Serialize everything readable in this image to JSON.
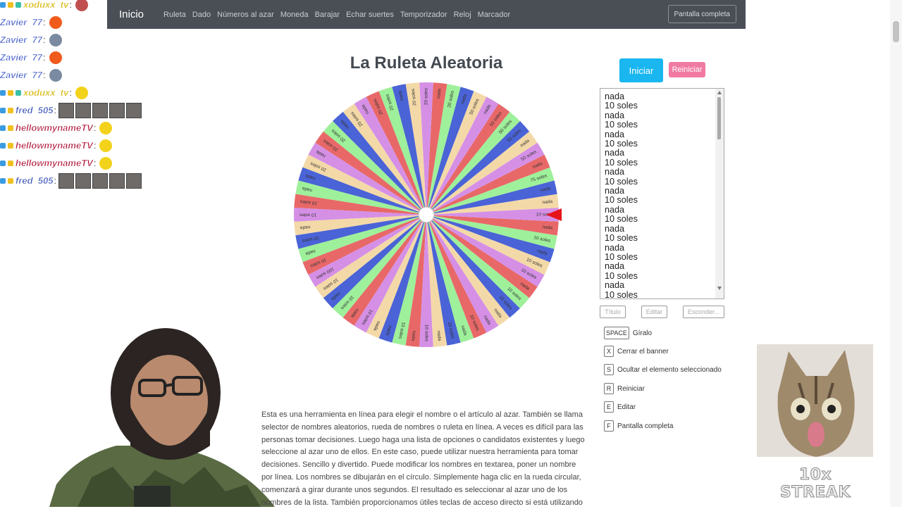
{
  "navbar": {
    "brand": "Inicio",
    "links": [
      "Ruleta",
      "Dado",
      "Números al azar",
      "Moneda",
      "Barajar",
      "Echar suertes",
      "Temporizador",
      "Reloj",
      "Marcador"
    ],
    "fullscreen": "Pantalla completa"
  },
  "chat": [
    {
      "user": "xoduxx_tv",
      "color": "#d4b400",
      "emotes": [
        "bomb-icon"
      ]
    },
    {
      "user": "Zavier_77",
      "color": "#4a63c9",
      "emotes": [
        "fire-icon"
      ]
    },
    {
      "user": "Zavier_77",
      "color": "#4a63c9",
      "emotes": [
        "bird-icon"
      ]
    },
    {
      "user": "Zavier_77",
      "color": "#4a63c9",
      "emotes": [
        "fire-icon"
      ]
    },
    {
      "user": "Zavier_77",
      "color": "#4a63c9",
      "emotes": [
        "bird-icon"
      ]
    },
    {
      "user": "xoduxx_tv",
      "color": "#d4b400",
      "emotes": [
        "clock-emote-icon"
      ]
    },
    {
      "user": "fred_505",
      "color": "#3a52b8",
      "emotes": [
        "face-emote-icon",
        "face-emote-icon",
        "face-emote-icon",
        "face-emote-icon",
        "face-emote-icon"
      ]
    },
    {
      "user": "hellowmynameTV",
      "color": "#b0183c",
      "emotes": [
        "clock-emote-icon"
      ]
    },
    {
      "user": "hellowmynameTV",
      "color": "#b0183c",
      "emotes": [
        "clock-emote-icon"
      ]
    },
    {
      "user": "hellowmynameTV",
      "color": "#b0183c",
      "emotes": [
        "clock-emote-icon"
      ]
    },
    {
      "user": "fred_505",
      "color": "#3a52b8",
      "emotes": [
        "face-emote-icon",
        "face-emote-icon",
        "face-emote-icon",
        "face-emote-icon",
        "face-emote-icon"
      ]
    }
  ],
  "main": {
    "title": "La Ruleta Aleatoria",
    "start_button": "Iniciar",
    "reset_button": "Reiniciar",
    "entries": [
      "nada",
      "10 soles",
      "nada",
      "10 soles",
      "nada",
      "10 soles",
      "nada",
      "10 soles",
      "nada",
      "10 soles",
      "nada",
      "10 soles",
      "nada",
      "10 soles",
      "nada",
      "10 soles",
      "nada",
      "10 soles",
      "nada",
      "10 soles",
      "nada",
      "10 soles"
    ],
    "small_buttons": [
      "Título",
      "Editar",
      "Esconder..."
    ],
    "shortcuts": [
      {
        "key": "SPACE",
        "label": "Gíralo"
      },
      {
        "key": "X",
        "label": "Cerrar el banner"
      },
      {
        "key": "S",
        "label": "Ocultar el elemento seleccionado"
      },
      {
        "key": "R",
        "label": "Reiniciar"
      },
      {
        "key": "E",
        "label": "Editar"
      },
      {
        "key": "F",
        "label": "Pantalla completa"
      }
    ],
    "description": "Esta es una herramienta en línea para elegir el nombre o el artículo al azar. También se llama selector de nombres aleatorios, rueda de nombres o ruleta en línea. A veces es difícil para las personas tomar decisiones. Luego haga una lista de opciones o candidatos existentes y luego seleccione al azar uno de ellos. En este caso, puede utilizar nuestra herramienta para tomar decisiones. Sencillo y divertido. Puede modificar los nombres en textarea, poner un nombre por línea. Los nombres se dibujarán en el círculo. Simplemente haga clic en la rueda circular, comenzará a girar durante unos segundos. El resultado es seleccionar al azar uno de los nombres de la lista. También proporcionamos útiles teclas de acceso directo si está utilizando"
  },
  "wheel": {
    "segment_colors": [
      "#f4d9a8",
      "#4a63d6",
      "#9ef09a",
      "#e86868",
      "#d590e6"
    ],
    "labels": [
      "nada",
      "nada",
      "75 soles",
      "nada",
      "50 soles",
      "nada",
      "50 soles",
      "50 soles",
      "50 soles",
      "nada",
      "50 soles",
      "nada",
      "20 soles",
      "nada",
      "20 soles",
      "20 soles",
      "nada",
      "20 soles",
      "20 soles",
      "nada",
      "20 soles",
      "nada",
      "20 soles",
      "20 soles",
      "nada",
      "20 soles",
      "nada",
      "nada",
      "10 soles",
      "10 soles",
      "nada",
      "10 soles",
      "nada",
      "10 soles",
      "100 soles",
      "10 soles",
      "nada",
      "10 soles",
      "nada",
      "10 soles",
      "nada",
      "nada",
      "10 soles",
      "nada",
      "10 soles",
      "nada",
      "10 soles",
      "nada",
      "10 soles",
      "nada",
      "nada",
      "10 soles",
      "10 soles",
      "nada",
      "10 soles",
      "10 soles",
      "nada",
      "10 soles",
      "nada",
      "10 soles"
    ]
  },
  "overlay": {
    "streak": "10x STREAK"
  }
}
